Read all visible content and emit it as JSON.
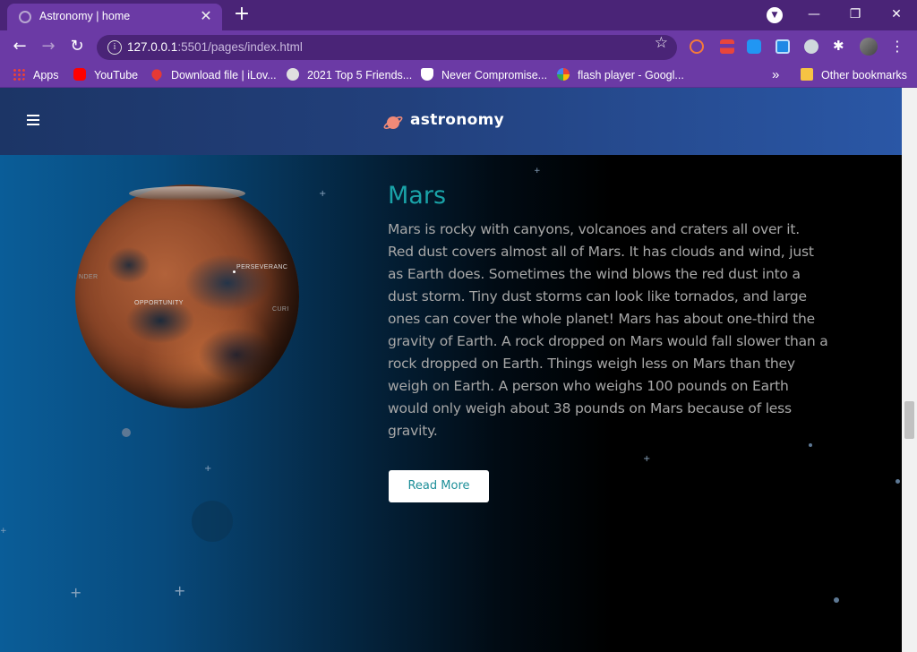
{
  "browser": {
    "tab_title": "Astronomy | home",
    "tab_close": "✕",
    "new_tab": "+",
    "url_host": "127.0.0.1",
    "url_path": ":5501/pages/index.html",
    "window_controls": {
      "minimize": "—",
      "restore": "❐",
      "close": "✕"
    }
  },
  "bookmarks": [
    {
      "label": "Apps",
      "icon": "apps-grid-icon"
    },
    {
      "label": "YouTube",
      "icon": "youtube-icon"
    },
    {
      "label": "Download file | iLov...",
      "icon": "ilovepdf-heart-icon"
    },
    {
      "label": "2021 Top 5 Friends...",
      "icon": "globe-icon"
    },
    {
      "label": "Never Compromise...",
      "icon": "shield-star-icon"
    },
    {
      "label": "flash player - Googl...",
      "icon": "google-icon"
    },
    {
      "label": "Other bookmarks",
      "icon": "folder-icon"
    }
  ],
  "bookmarks_overflow": "»",
  "site": {
    "brand": "astronomy",
    "logo_icon": "planet-icon",
    "menu_icon": "hamburger-icon"
  },
  "mars": {
    "title": "Mars",
    "description": "Mars is rocky with canyons, volcanoes and craters all over it. Red dust covers almost all of Mars. It has clouds and wind, just as Earth does. Sometimes the wind blows the red dust into a dust storm. Tiny dust storms can look like tornados, and large ones can cover the whole planet! Mars has about one-third the gravity of Earth. A rock dropped on Mars would fall slower than a rock dropped on Earth. Things weigh less on Mars than they weigh on Earth. A person who weighs 100 pounds on Earth would only weigh about 38 pounds on Mars because of less gravity.",
    "read_more": "Read More",
    "globe_labels": {
      "perseverance": "PERSEVERANC",
      "opportunity": "OPPORTUNITY",
      "insight": "NDER",
      "curiosity": "CURI"
    }
  },
  "colors": {
    "chrome_dark": "#4a2477",
    "chrome": "#6b3aa5",
    "accent_teal": "#1aa3a8",
    "text_gray": "#a7a7a7"
  }
}
